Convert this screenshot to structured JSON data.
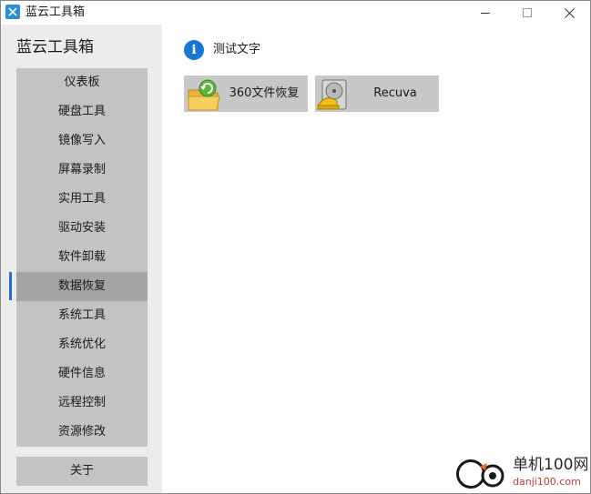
{
  "window": {
    "title": "蓝云工具箱"
  },
  "sidebar": {
    "title": "蓝云工具箱",
    "items": [
      {
        "label": "仪表板"
      },
      {
        "label": "硬盘工具"
      },
      {
        "label": "镜像写入"
      },
      {
        "label": "屏幕录制"
      },
      {
        "label": "实用工具"
      },
      {
        "label": "驱动安装"
      },
      {
        "label": "软件卸载"
      },
      {
        "label": "数据恢复"
      },
      {
        "label": "系统工具"
      },
      {
        "label": "系统优化"
      },
      {
        "label": "硬件信息"
      },
      {
        "label": "远程控制"
      },
      {
        "label": "资源修改"
      }
    ],
    "active_item": "数据恢复",
    "about_label": "关于"
  },
  "main": {
    "info_text": "测试文字",
    "tools": [
      {
        "label": "360文件恢复",
        "icon": "folder-restore-icon"
      },
      {
        "label": "Recuva",
        "icon": "recuva-disk-icon"
      }
    ]
  },
  "watermark": {
    "name": "单机100网",
    "url": "danji100.com"
  },
  "colors": {
    "accent": "#1f6fd0",
    "info": "#1976d2",
    "nav_bg": "#c3c3c3",
    "nav_active": "#a4a4a4"
  }
}
